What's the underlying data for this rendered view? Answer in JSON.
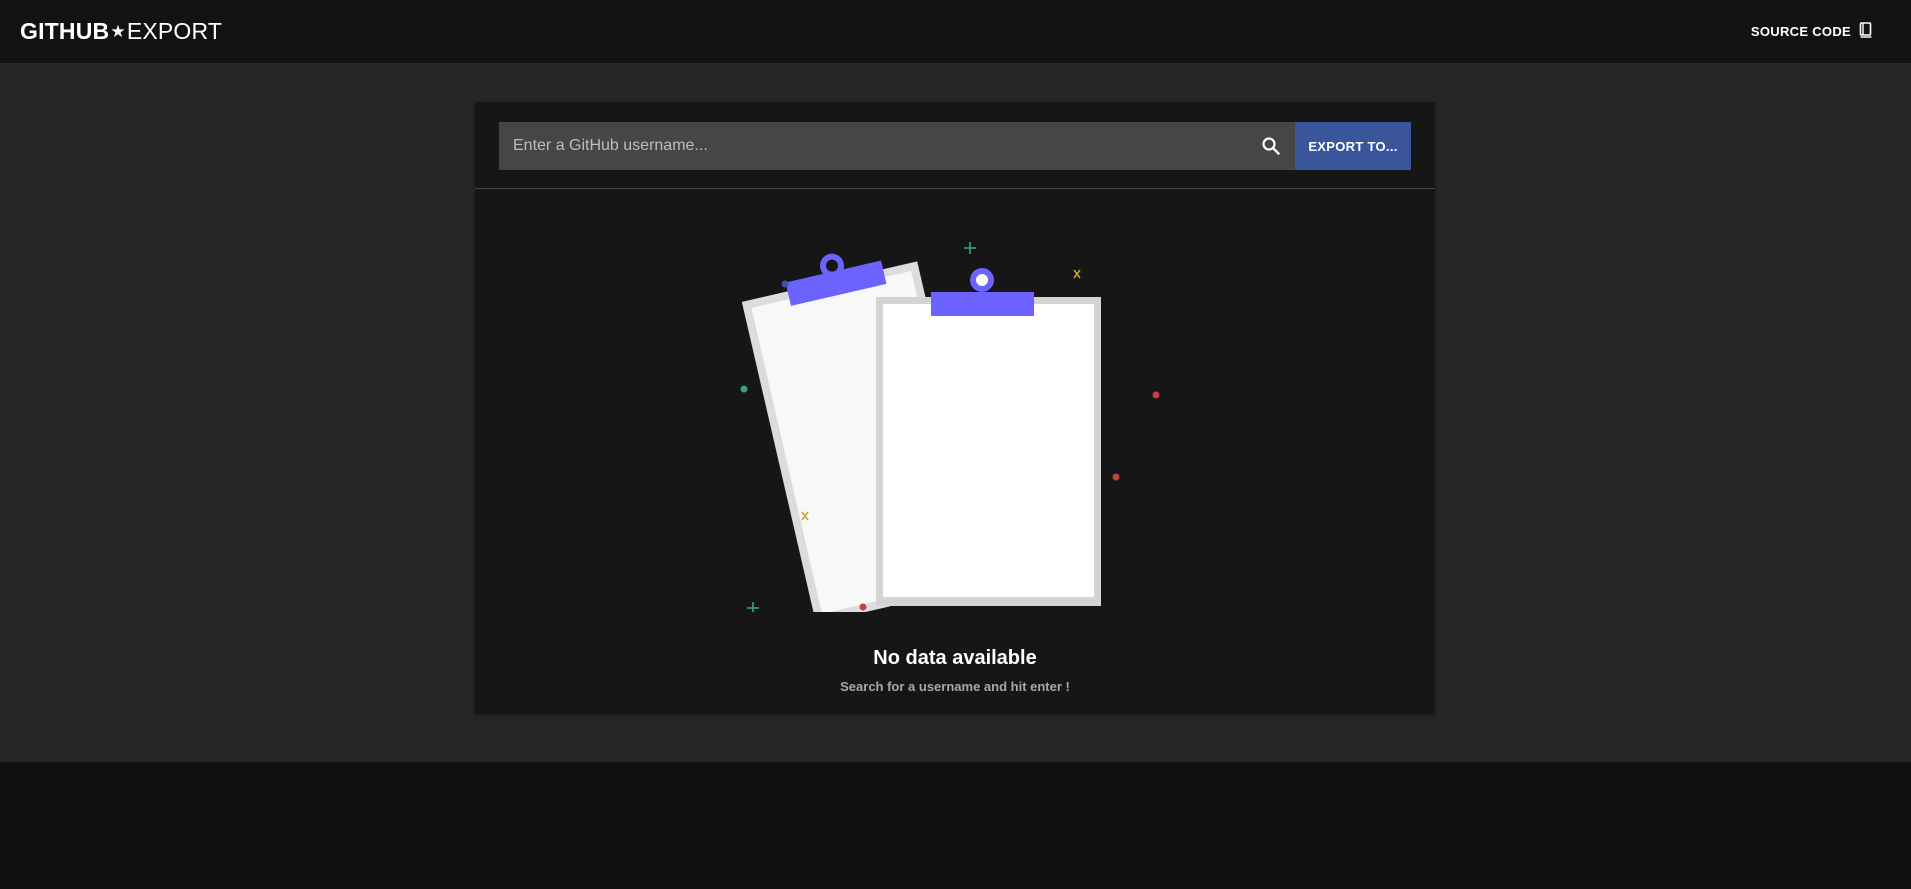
{
  "header": {
    "logo_bold": "GITHUB",
    "logo_star": "★",
    "logo_light": "EXPORT",
    "source_code_label": "SOURCE CODE",
    "source_code_icon": "book-icon"
  },
  "search": {
    "placeholder": "Enter a GitHub username...",
    "value": "",
    "search_icon": "search-icon",
    "export_label": "EXPORT TO..."
  },
  "empty_state": {
    "title": "No data available",
    "subtitle": "Search for a username and hit enter !",
    "illustration": "clipboards-illustration"
  },
  "colors": {
    "accent": "#6c63ff",
    "export_button": "#3a5599",
    "page_bg": "#262626",
    "card_bg": "#161616"
  }
}
